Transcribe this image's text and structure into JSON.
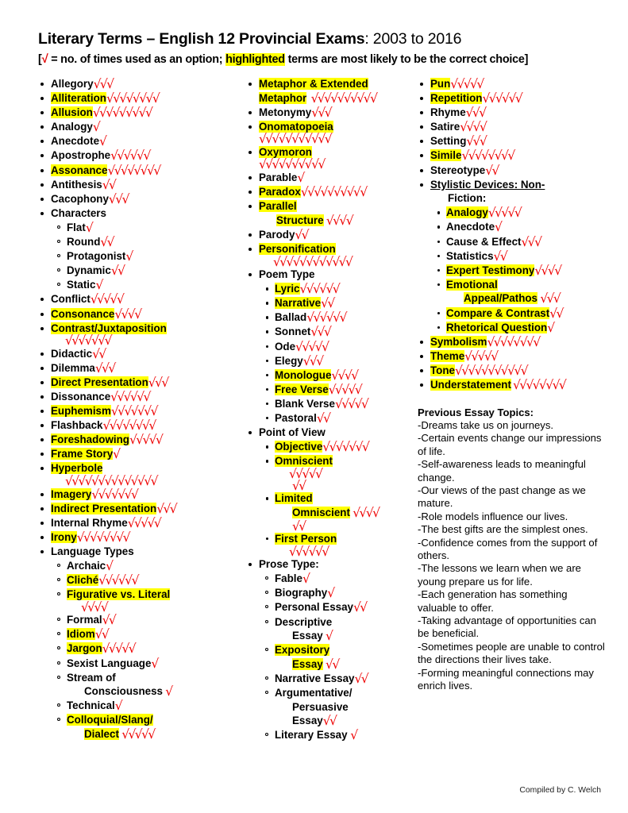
{
  "header": {
    "title_bold": "Literary Terms – English 12 Provincial Exams",
    "title_light": ": 2003 to 2016",
    "subtitle_open": "[",
    "subtitle_tick": "√",
    "subtitle_pre": " = no. of times used as an option; ",
    "subtitle_hl": "highlighted",
    "subtitle_post": " terms are most likely to be the correct choice]"
  },
  "tick_char": "√",
  "colors": {
    "highlight": "#ffff00",
    "tick": "#ee0000",
    "text": "#000000"
  },
  "column1": [
    {
      "label": "Allegory",
      "ticks": 3,
      "hl": false,
      "level": 1,
      "bullet": "disc"
    },
    {
      "label": "Alliteration",
      "ticks": 8,
      "hl": true,
      "level": 1,
      "bullet": "disc"
    },
    {
      "label": "Allusion",
      "ticks": 9,
      "hl": true,
      "level": 1,
      "bullet": "disc"
    },
    {
      "label": "Analogy",
      "ticks": 1,
      "hl": false,
      "level": 1,
      "bullet": "disc"
    },
    {
      "label": "Anecdote",
      "ticks": 1,
      "hl": false,
      "level": 1,
      "bullet": "disc"
    },
    {
      "label": "Apostrophe",
      "ticks": 6,
      "hl": false,
      "level": 1,
      "bullet": "disc"
    },
    {
      "label": "Assonance",
      "ticks": 8,
      "hl": true,
      "level": 1,
      "bullet": "disc"
    },
    {
      "label": "Antithesis",
      "ticks": 2,
      "hl": false,
      "level": 1,
      "bullet": "disc"
    },
    {
      "label": "Cacophony",
      "ticks": 3,
      "hl": false,
      "level": 1,
      "bullet": "disc"
    },
    {
      "label": "Characters",
      "ticks": 0,
      "hl": false,
      "level": 1,
      "bullet": "disc"
    },
    {
      "label": "Flat",
      "ticks": 1,
      "hl": false,
      "level": 2,
      "bullet": "circle"
    },
    {
      "label": "Round",
      "ticks": 2,
      "hl": false,
      "level": 2,
      "bullet": "circle"
    },
    {
      "label": "Protagonist",
      "ticks": 1,
      "hl": false,
      "level": 2,
      "bullet": "circle"
    },
    {
      "label": "Dynamic",
      "ticks": 2,
      "hl": false,
      "level": 2,
      "bullet": "circle"
    },
    {
      "label": "Static",
      "ticks": 1,
      "hl": false,
      "level": 2,
      "bullet": "circle"
    },
    {
      "label": "Conflict",
      "ticks": 5,
      "hl": false,
      "level": 1,
      "bullet": "disc"
    },
    {
      "label": "Consonance",
      "ticks": 4,
      "hl": true,
      "level": 1,
      "bullet": "disc"
    },
    {
      "label": "Contrast/Juxtaposition",
      "ticks": 7,
      "hl": true,
      "level": 1,
      "bullet": "disc",
      "wrap_ticks": true
    },
    {
      "label": "Didactic",
      "ticks": 2,
      "hl": false,
      "level": 1,
      "bullet": "disc"
    },
    {
      "label": "Dilemma",
      "ticks": 3,
      "hl": false,
      "level": 1,
      "bullet": "disc"
    },
    {
      "label": "Direct Presentation",
      "ticks": 3,
      "hl": true,
      "level": 1,
      "bullet": "disc"
    },
    {
      "label": "Dissonance",
      "ticks": 6,
      "hl": false,
      "level": 1,
      "bullet": "disc"
    },
    {
      "label": "Euphemism",
      "ticks": 7,
      "hl": true,
      "level": 1,
      "bullet": "disc"
    },
    {
      "label": "Flashback",
      "ticks": 8,
      "hl": false,
      "level": 1,
      "bullet": "disc"
    },
    {
      "label": "Foreshadowing",
      "ticks": 5,
      "hl": true,
      "level": 1,
      "bullet": "disc"
    },
    {
      "label": "Frame Story",
      "ticks": 1,
      "hl": true,
      "level": 1,
      "bullet": "disc"
    },
    {
      "label": "Hyperbole",
      "ticks": 14,
      "hl": true,
      "level": 1,
      "bullet": "disc",
      "wrap_ticks": true
    },
    {
      "label": "Imagery",
      "ticks": 7,
      "hl": true,
      "level": 1,
      "bullet": "disc"
    },
    {
      "label": "Indirect Presentation",
      "ticks": 3,
      "hl": true,
      "level": 1,
      "bullet": "disc"
    },
    {
      "label": "Internal Rhyme",
      "ticks": 5,
      "hl": false,
      "level": 1,
      "bullet": "disc"
    },
    {
      "label": "Irony",
      "ticks": 8,
      "hl": true,
      "level": 1,
      "bullet": "disc"
    },
    {
      "label": "Language Types",
      "ticks": 0,
      "hl": false,
      "level": 1,
      "bullet": "disc"
    },
    {
      "label": "Archaic",
      "ticks": 1,
      "hl": false,
      "level": 2,
      "bullet": "circle"
    },
    {
      "label": "Cliché",
      "ticks": 6,
      "hl": true,
      "level": 2,
      "bullet": "circle"
    },
    {
      "label": "Figurative vs. Literal",
      "ticks": 4,
      "hl": true,
      "level": 2,
      "bullet": "circle",
      "wrap_ticks": true
    },
    {
      "label": "Formal",
      "ticks": 2,
      "hl": false,
      "level": 2,
      "bullet": "circle"
    },
    {
      "label": "Idiom",
      "ticks": 2,
      "hl": true,
      "level": 2,
      "bullet": "circle"
    },
    {
      "label": "Jargon",
      "ticks": 5,
      "hl": true,
      "level": 2,
      "bullet": "circle"
    },
    {
      "label": "Sexist Language",
      "ticks": 1,
      "hl": false,
      "level": 2,
      "bullet": "circle"
    },
    {
      "label": "Stream of",
      "label2": "Consciousness",
      "ticks": 1,
      "hl": false,
      "level": 2,
      "bullet": "circle",
      "two_line": true
    },
    {
      "label": "Technical",
      "ticks": 1,
      "hl": false,
      "level": 2,
      "bullet": "circle"
    },
    {
      "label": "Colloquial/Slang/",
      "label2": "Dialect",
      "ticks": 5,
      "hl": true,
      "level": 2,
      "bullet": "circle",
      "two_line": true
    }
  ],
  "column2": [
    {
      "label": "Metaphor & Extended",
      "label2": "Metaphor",
      "ticks": 10,
      "hl": true,
      "level": 1,
      "bullet": "disc",
      "two_line": true,
      "outdent2": true
    },
    {
      "label": "Metonymy",
      "ticks": 3,
      "hl": false,
      "level": 1,
      "bullet": "disc"
    },
    {
      "label": "Onomatopoeia",
      "ticks": 11,
      "hl": true,
      "level": 1,
      "bullet": "disc",
      "wrap_ticks": true,
      "tick_outdent": true
    },
    {
      "label": "Oxymoron",
      "ticks": 10,
      "hl": true,
      "level": 1,
      "bullet": "disc",
      "wrap_ticks": true,
      "tick_outdent": true
    },
    {
      "label": "Parable",
      "ticks": 1,
      "hl": false,
      "level": 1,
      "bullet": "disc"
    },
    {
      "label": "Paradox",
      "ticks": 10,
      "hl": true,
      "level": 1,
      "bullet": "disc"
    },
    {
      "label": "Parallel",
      "label2": "Structure",
      "ticks": 4,
      "hl": true,
      "level": 1,
      "bullet": "disc",
      "two_line": true
    },
    {
      "label": "Parody",
      "ticks": 2,
      "hl": false,
      "level": 1,
      "bullet": "disc"
    },
    {
      "label": "Personification",
      "ticks": 12,
      "hl": true,
      "level": 1,
      "bullet": "disc",
      "wrap_ticks": true
    },
    {
      "label": "Poem Type",
      "ticks": 0,
      "hl": false,
      "level": 1,
      "bullet": "disc"
    },
    {
      "label": "Lyric",
      "ticks": 6,
      "hl": true,
      "level": 2,
      "bullet": "small"
    },
    {
      "label": "Narrative",
      "ticks": 2,
      "hl": true,
      "level": 2,
      "bullet": "small"
    },
    {
      "label": "Ballad",
      "ticks": 6,
      "hl": false,
      "level": 2,
      "bullet": "small"
    },
    {
      "label": "Sonnet",
      "ticks": 3,
      "hl": false,
      "level": 2,
      "bullet": "small"
    },
    {
      "label": "Ode",
      "ticks": 5,
      "hl": false,
      "level": 2,
      "bullet": "small"
    },
    {
      "label": "Elegy",
      "ticks": 3,
      "hl": false,
      "level": 2,
      "bullet": "small"
    },
    {
      "label": "Monologue",
      "ticks": 4,
      "hl": true,
      "level": 2,
      "bullet": "small"
    },
    {
      "label": "Free Verse",
      "ticks": 5,
      "hl": true,
      "level": 2,
      "bullet": "small"
    },
    {
      "label": "Blank Verse",
      "ticks": 5,
      "hl": false,
      "level": 2,
      "bullet": "small"
    },
    {
      "label": "Pastoral",
      "ticks": 2,
      "hl": false,
      "level": 2,
      "bullet": "small"
    },
    {
      "label": "Point of View",
      "ticks": 0,
      "hl": false,
      "level": 1,
      "bullet": "disc"
    },
    {
      "label": "Objective",
      "ticks": 7,
      "hl": true,
      "level": 2,
      "bullet": "small"
    },
    {
      "label": "Omniscient",
      "ticks": 5,
      "ticks2": 2,
      "hl": true,
      "level": 2,
      "bullet": "small",
      "wrap_ticks": true
    },
    {
      "label": "Limited",
      "label2": "Omniscient",
      "ticks": 4,
      "ticks2": 2,
      "hl": true,
      "level": 2,
      "bullet": "small",
      "two_line": true,
      "wrap_ticks": true
    },
    {
      "label": "First Person",
      "ticks": 6,
      "hl": true,
      "level": 2,
      "bullet": "small",
      "wrap_ticks": true
    },
    {
      "label": "Prose Type:",
      "ticks": 0,
      "hl": false,
      "level": 1,
      "bullet": "disc"
    },
    {
      "label": "Fable",
      "ticks": 1,
      "hl": false,
      "level": 2,
      "bullet": "circle"
    },
    {
      "label": "Biography",
      "ticks": 1,
      "hl": false,
      "level": 2,
      "bullet": "circle"
    },
    {
      "label": "Personal Essay",
      "ticks": 2,
      "hl": false,
      "level": 2,
      "bullet": "circle"
    },
    {
      "label": "Descriptive",
      "label2": "Essay",
      "ticks": 1,
      "hl": false,
      "level": 2,
      "bullet": "circle",
      "two_line": true
    },
    {
      "label": "Expository",
      "label2": "Essay",
      "ticks": 2,
      "hl": true,
      "level": 2,
      "bullet": "circle",
      "two_line": true
    },
    {
      "label": "Narrative Essay",
      "ticks": 2,
      "hl": false,
      "level": 2,
      "bullet": "circle"
    },
    {
      "label": "Argumentative/",
      "label2": "Persuasive",
      "label3": "Essay",
      "ticks": 2,
      "hl": false,
      "level": 2,
      "bullet": "circle",
      "three_line": true
    },
    {
      "label": "Literary Essay ",
      "ticks": 1,
      "hl": false,
      "level": 2,
      "bullet": "circle"
    }
  ],
  "column3": [
    {
      "label": "Pun",
      "ticks": 5,
      "hl": true,
      "level": 1,
      "bullet": "disc"
    },
    {
      "label": "Repetition",
      "ticks": 6,
      "hl": true,
      "level": 1,
      "bullet": "disc"
    },
    {
      "label": "Rhyme",
      "ticks": 3,
      "hl": false,
      "level": 1,
      "bullet": "disc"
    },
    {
      "label": "Satire",
      "ticks": 4,
      "hl": false,
      "level": 1,
      "bullet": "disc"
    },
    {
      "label": "Setting",
      "ticks": 3,
      "hl": false,
      "level": 1,
      "bullet": "disc"
    },
    {
      "label": "Simile",
      "ticks": 8,
      "hl": true,
      "level": 1,
      "bullet": "disc"
    },
    {
      "label": "Stereotype",
      "ticks": 2,
      "hl": false,
      "level": 1,
      "bullet": "disc"
    },
    {
      "label": "Stylistic Devices: Non-",
      "label2": "Fiction:",
      "ticks": 0,
      "hl": false,
      "level": 1,
      "bullet": "disc",
      "two_line": true,
      "underline": true
    },
    {
      "label": "Analogy",
      "ticks": 5,
      "hl": true,
      "level": 2,
      "bullet": "small"
    },
    {
      "label": "Anecdote",
      "ticks": 1,
      "hl": false,
      "level": 2,
      "bullet": "small"
    },
    {
      "label": "Cause & Effect",
      "ticks": 3,
      "hl": false,
      "level": 2,
      "bullet": "small"
    },
    {
      "label": "Statistics",
      "ticks": 2,
      "hl": false,
      "level": 2,
      "bullet": "small"
    },
    {
      "label": "Expert  Testimony",
      "ticks": 4,
      "hl": true,
      "level": 2,
      "bullet": "small"
    },
    {
      "label": "Emotional",
      "label2": "Appeal/Pathos",
      "ticks": 3,
      "hl": true,
      "level": 2,
      "bullet": "small",
      "two_line": true
    },
    {
      "label": "Compare & Contrast",
      "ticks": 2,
      "hl": true,
      "level": 2,
      "bullet": "small"
    },
    {
      "label": "Rhetorical Question",
      "ticks": 1,
      "hl": true,
      "level": 2,
      "bullet": "small"
    },
    {
      "label": "Symbolism",
      "ticks": 8,
      "hl": true,
      "level": 1,
      "bullet": "disc"
    },
    {
      "label": "Theme",
      "ticks": 5,
      "hl": true,
      "level": 1,
      "bullet": "disc"
    },
    {
      "label": "Tone",
      "ticks": 11,
      "hl": true,
      "level": 1,
      "bullet": "disc"
    },
    {
      "label": "Understatement",
      "ticks": 8,
      "hl": true,
      "level": 1,
      "bullet": "disc",
      "tick_space": true
    }
  ],
  "essays": {
    "heading": "Previous Essay Topics:",
    "topics": [
      "-Dreams take us on journeys.",
      "-Certain events change our impressions of life.",
      "-Self-awareness leads to meaningful change.",
      "-Our views of the past change as we mature.",
      "-Role models influence our lives.",
      "-The best gifts are the simplest ones.",
      "-Confidence comes from the support of others.",
      "-The lessons we learn when we are young prepare us for life.",
      "-Each generation has something valuable to offer.",
      "-Taking advantage of opportunities can be beneficial.",
      "-Sometimes people are unable to control the directions their lives take.",
      "-Forming meaningful connections may enrich lives."
    ]
  },
  "footer": {
    "credit": "Compiled by C. Welch"
  }
}
